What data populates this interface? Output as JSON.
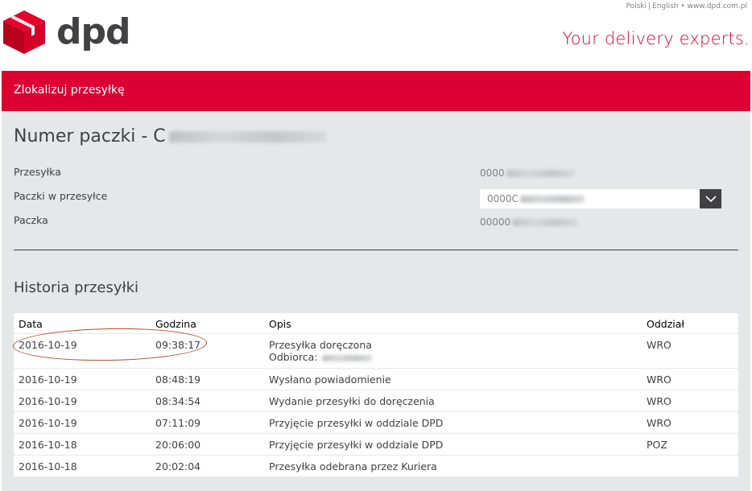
{
  "top_links": {
    "lang1": "Polski",
    "separator": "|",
    "lang2": "English",
    "bullet": "•",
    "site": "www.dpd.com.pl"
  },
  "brand": {
    "wordmark": "dpd",
    "tagline": "Your delivery experts.",
    "accent": "#dc0032"
  },
  "nav": {
    "title": "Zlokalizuj przesyłkę"
  },
  "parcel": {
    "heading": "Numer paczki - C",
    "fields": [
      {
        "label": "Przesyłka",
        "value": "0000"
      },
      {
        "label": "Paczki w przesyłce",
        "value": "0000C"
      },
      {
        "label": "Paczka",
        "value": "00000"
      }
    ],
    "select_icon": "chevron-down-icon"
  },
  "history": {
    "title": "Historia przesyłki",
    "columns": [
      "Data",
      "Godzina",
      "Opis",
      "Oddział"
    ],
    "rows": [
      {
        "date": "2016-10-19",
        "time": "09:38:17",
        "desc": "Przesyłka doręczona",
        "desc2": "Odbiorca:",
        "branch": "WRO"
      },
      {
        "date": "2016-10-19",
        "time": "08:48:19",
        "desc": "Wysłano powiadomienie",
        "branch": "WRO"
      },
      {
        "date": "2016-10-19",
        "time": "08:34:54",
        "desc": "Wydanie przesyłki do doręczenia",
        "branch": "WRO"
      },
      {
        "date": "2016-10-19",
        "time": "07:11:09",
        "desc": "Przyjęcie przesyłki w oddziale DPD",
        "branch": "WRO"
      },
      {
        "date": "2016-10-18",
        "time": "20:06:00",
        "desc": "Przyjęcie przesyłki w oddziale DPD",
        "branch": "POZ"
      },
      {
        "date": "2016-10-18",
        "time": "20:02:04",
        "desc": "Przesyłka odebrana przez Kuriera",
        "branch": ""
      }
    ]
  }
}
